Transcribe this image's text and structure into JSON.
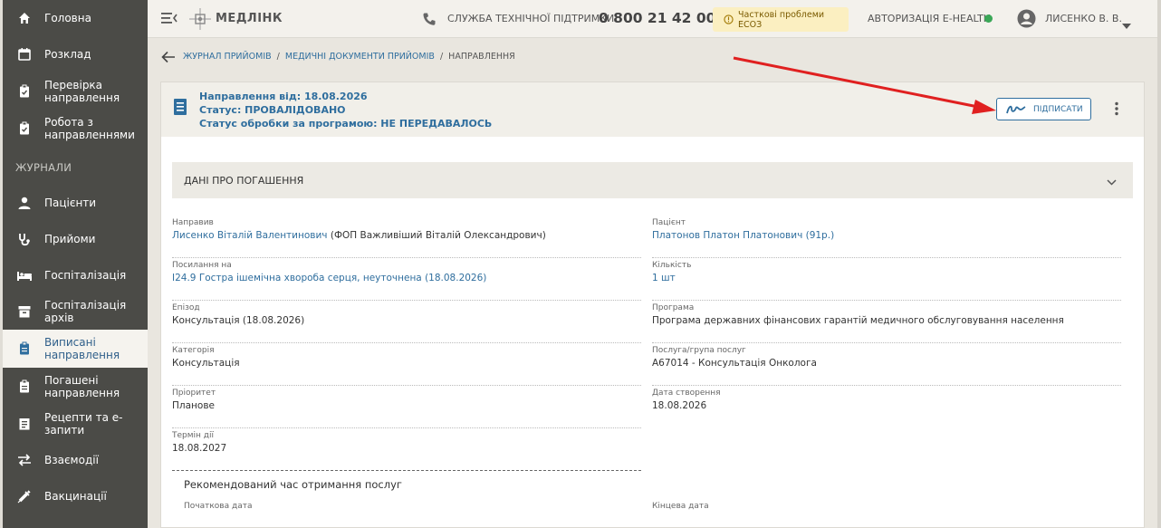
{
  "sidebar": {
    "items": [
      {
        "label": "Головна",
        "icon": "home-icon"
      },
      {
        "label": "Розклад",
        "icon": "calendar-icon"
      },
      {
        "label": "Перевірка направлення",
        "icon": "clipboard-check-icon"
      },
      {
        "label": "Робота з направленнями",
        "icon": "clipboard-check-icon"
      },
      {
        "label": "Пацієнти",
        "icon": "person-icon"
      },
      {
        "label": "Прийоми",
        "icon": "stethoscope-icon"
      },
      {
        "label": "Госпіталізація",
        "icon": "bed-icon"
      },
      {
        "label": "Госпіталізація архів",
        "icon": "archive-icon"
      },
      {
        "label": "Виписані направлення",
        "icon": "clipboard-icon"
      },
      {
        "label": "Погашені направлення",
        "icon": "clipboard-icon"
      },
      {
        "label": "Рецепти та е-запити",
        "icon": "receipt-icon"
      },
      {
        "label": "Взаємодії",
        "icon": "swap-icon"
      },
      {
        "label": "Вакцинації",
        "icon": "syringe-icon"
      }
    ],
    "section_label": "ЖУРНАЛИ"
  },
  "topbar": {
    "logo": "МЕДЛІНК",
    "support_label": "СЛУЖБА ТЕХНІЧНОЇ ПІДТРИМКИ",
    "phone": "0 800 21 42 00",
    "warning": "Часткові проблеми ЕСОЗ",
    "ehealth": "АВТОРИЗАЦІЯ E-HEALTH",
    "user": "ЛИСЕНКО В. В."
  },
  "breadcrumb": {
    "items": [
      "ЖУРНАЛ ПРИЙОМІВ",
      "МЕДИЧНІ ДОКУМЕНТИ ПРИЙОМІВ",
      "НАПРАВЛЕННЯ"
    ],
    "sep": "/"
  },
  "header": {
    "line1": "Направлення від: 18.08.2026",
    "line2": "Статус: ПРОВАЛІДОВАНО",
    "line3": "Статус обробки за програмою: НЕ ПЕРЕДАВАЛОСЬ",
    "sign_button": "ПІДПИСАТИ"
  },
  "section": {
    "title": "ДАНІ ПРО ПОГАШЕННЯ"
  },
  "fields_left": [
    {
      "label": "Направив",
      "value": "Лисенко Віталій Валентинович",
      "extra": " (ФОП Важливіший Віталій Олександрович)"
    },
    {
      "label": "Посилання на",
      "value": "I24.9 Гостра ішемічна хвороба серця, неуточнена (18.08.2026)"
    },
    {
      "label": "Епізод",
      "value": "Консультація (18.08.2026)"
    },
    {
      "label": "Категорія",
      "value": "Консультація"
    },
    {
      "label": "Пріоритет",
      "value": "Планове"
    },
    {
      "label": "Термін дії",
      "value": "18.08.2027"
    }
  ],
  "fields_right": [
    {
      "label": "Пацієнт",
      "value": "Платонов Платон Платонович (91р.)"
    },
    {
      "label": "Кількість",
      "value": "1 шт"
    },
    {
      "label": "Програма",
      "value": "Програма державних фінансових гарантій медичного обслуговування населення"
    },
    {
      "label": "Послуга/група послуг",
      "value": "А67014 - Консультація Онколога"
    },
    {
      "label": "Дата створення",
      "value": "18.08.2026"
    }
  ],
  "recommended": {
    "title": "Рекомендований час отримання послуг",
    "start_label": "Початкова дата",
    "end_label": "Кінцева дата"
  },
  "colors": {
    "accent": "#2f6e9e",
    "sidebar": "#4b4b47",
    "arrow": "#e02020",
    "ok": "#3aa757"
  }
}
